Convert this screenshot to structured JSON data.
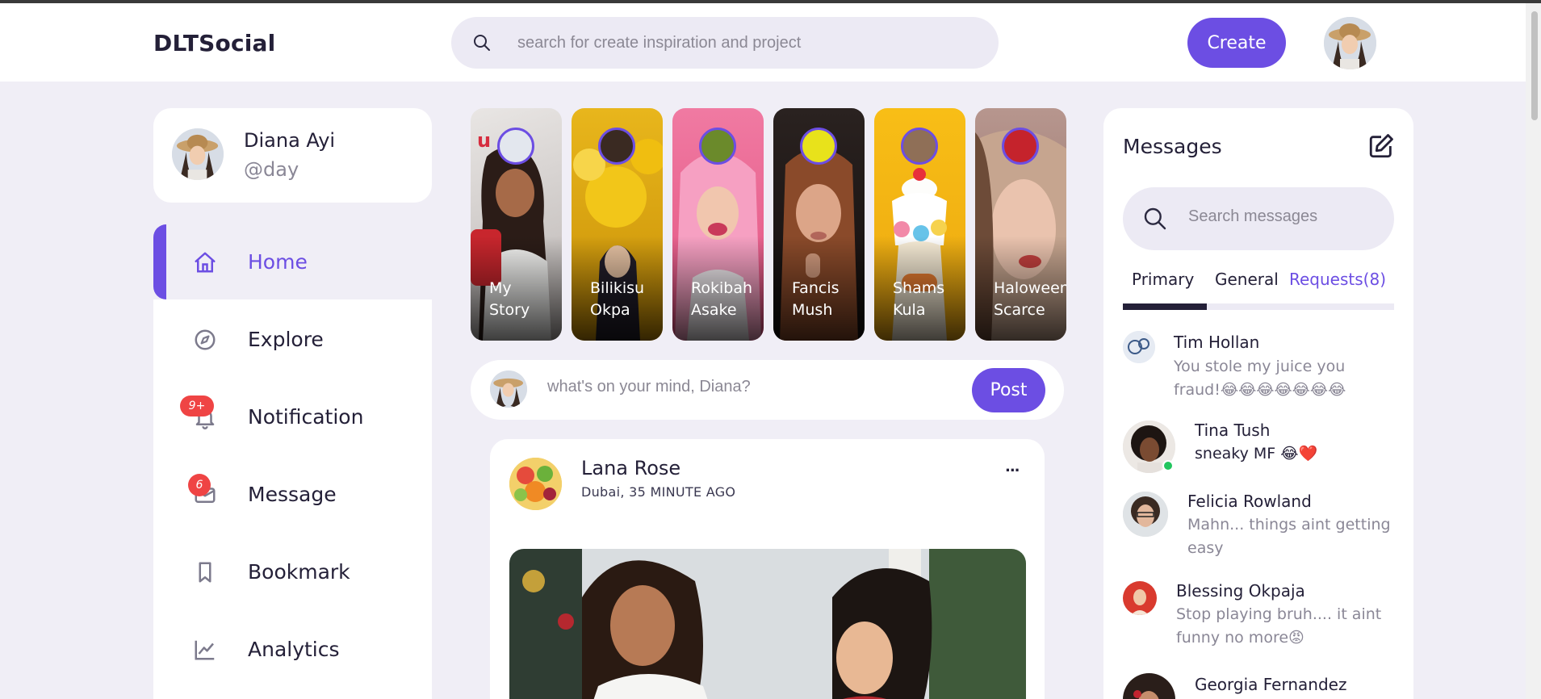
{
  "app": {
    "logo": "DLTSocial",
    "search_placeholder": "search for create inspiration and project",
    "create_label": "Create"
  },
  "profile": {
    "name": "Diana Ayi",
    "handle": "@day"
  },
  "sidebar": {
    "items": [
      {
        "label": "Home",
        "icon": "home-icon"
      },
      {
        "label": "Explore",
        "icon": "compass-icon"
      },
      {
        "label": "Notification",
        "icon": "bell-icon",
        "badge": "9+"
      },
      {
        "label": "Message",
        "icon": "mail-icon",
        "badge": "6"
      },
      {
        "label": "Bookmark",
        "icon": "bookmark-icon"
      },
      {
        "label": "Analytics",
        "icon": "chart-icon"
      }
    ]
  },
  "stories": [
    {
      "line1": "My",
      "line2": "Story"
    },
    {
      "line1": "Bilikisu",
      "line2": "Okpa"
    },
    {
      "line1": "Rokibah",
      "line2": "Asake"
    },
    {
      "line1": "Fancis",
      "line2": "Mush"
    },
    {
      "line1": "Shams",
      "line2": "Kula"
    },
    {
      "line1": "Haloween",
      "line2": "Scarce"
    }
  ],
  "composer": {
    "placeholder": "what's on your mind, Diana?",
    "post_label": "Post"
  },
  "feed": {
    "post": {
      "author": "Lana Rose",
      "meta": "Dubai, 35 MINUTE AGO",
      "more": "..."
    }
  },
  "messages": {
    "title": "Messages",
    "search_placeholder": "Search messages",
    "tabs": {
      "primary": "Primary",
      "general": "General",
      "requests": "Requests(8)"
    },
    "items": [
      {
        "name": "Tim Hollan",
        "text": "You stole my juice you fraud!😂😂😂😂😂😂😂"
      },
      {
        "name": "Tina Tush",
        "text": "sneaky MF 😂❤️"
      },
      {
        "name": "Felicia Rowland",
        "text": "Mahn... things aint getting easy"
      },
      {
        "name": "Blessing Okpaja",
        "text": "Stop playing bruh.... it aint funny no more😡"
      },
      {
        "name": "Georgia Fernandez",
        "text": ""
      }
    ]
  },
  "colors": {
    "accent": "#6c4ee3",
    "background": "#f0eef6",
    "badge": "#ef4444",
    "online": "#22c55e"
  }
}
